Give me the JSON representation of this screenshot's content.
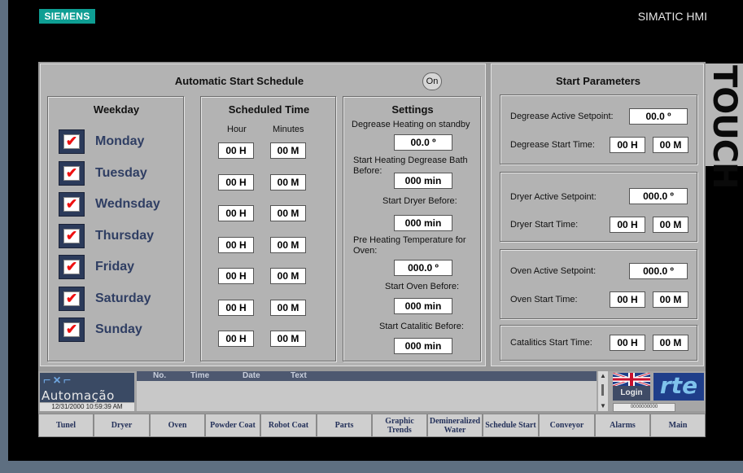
{
  "brand": {
    "logo_text": "SIEMENS",
    "product": "SIMATIC HMI",
    "touch_label": "TOUCH"
  },
  "schedule": {
    "title": "Automatic Start Schedule",
    "on_button": "On",
    "weekday": {
      "title": "Weekday",
      "days": [
        "Monday",
        "Tuesday",
        "Wednsday",
        "Thursday",
        "Friday",
        "Saturday",
        "Sunday"
      ],
      "checked": [
        true,
        true,
        true,
        true,
        true,
        true,
        true
      ]
    },
    "time": {
      "title": "Scheduled Time",
      "hour_label": "Hour",
      "minutes_label": "Minutes",
      "rows": [
        {
          "h": "00 H",
          "m": "00 M"
        },
        {
          "h": "00 H",
          "m": "00 M"
        },
        {
          "h": "00 H",
          "m": "00 M"
        },
        {
          "h": "00 H",
          "m": "00 M"
        },
        {
          "h": "00 H",
          "m": "00 M"
        },
        {
          "h": "00 H",
          "m": "00 M"
        },
        {
          "h": "00 H",
          "m": "00 M"
        }
      ]
    },
    "settings": {
      "title": "Settings",
      "degrease_label": "Degrease Heating on standby",
      "degrease_value": "00.0 º",
      "start_heating_label": "Start Heating Degrease Bath Before:",
      "start_heating_value": "000 min",
      "dryer_label": "Start  Dryer Before:",
      "dryer_value": "000 min",
      "preheat_label": "Pre Heating Temperature for Oven:",
      "preheat_value": "000.0 º",
      "oven_label": "Start Oven Before:",
      "oven_value": "000 min",
      "catalitic_label": "Start Catalitic Before:",
      "catalitic_value": "000 min"
    }
  },
  "params": {
    "title": "Start Parameters",
    "degrease": {
      "setpoint_label": "Degrease Active Setpoint:",
      "setpoint": "00.0 º",
      "time_label": "Degrease Start Time:",
      "h": "00 H",
      "m": "00 M"
    },
    "dryer": {
      "setpoint_label": "Dryer Active Setpoint:",
      "setpoint": "000.0 º",
      "time_label": "Dryer Start Time:",
      "h": "00 H",
      "m": "00 M"
    },
    "oven": {
      "setpoint_label": "Oven Active Setpoint:",
      "setpoint": "000.0 º",
      "time_label": "Oven Start Time:",
      "h": "00 H",
      "m": "00 M"
    },
    "catalitics": {
      "time_label": "Catalitics  Start Time:",
      "h": "00 H",
      "m": "00 M"
    }
  },
  "statusbar": {
    "company": "Automação",
    "datetime": "12/31/2000 10:59:39 AM",
    "alarm_cols": [
      "No.",
      "Time",
      "Date",
      "Text"
    ],
    "login": "Login",
    "user": "0000000000",
    "partner_logo": "rte"
  },
  "nav": [
    "Tunel",
    "Dryer",
    "Oven",
    "Powder Coat",
    "Robot Coat",
    "Parts",
    "Graphic Trends",
    "Demineralized Water",
    "Schedule Start",
    "Conveyor",
    "Alarms",
    "Main"
  ]
}
